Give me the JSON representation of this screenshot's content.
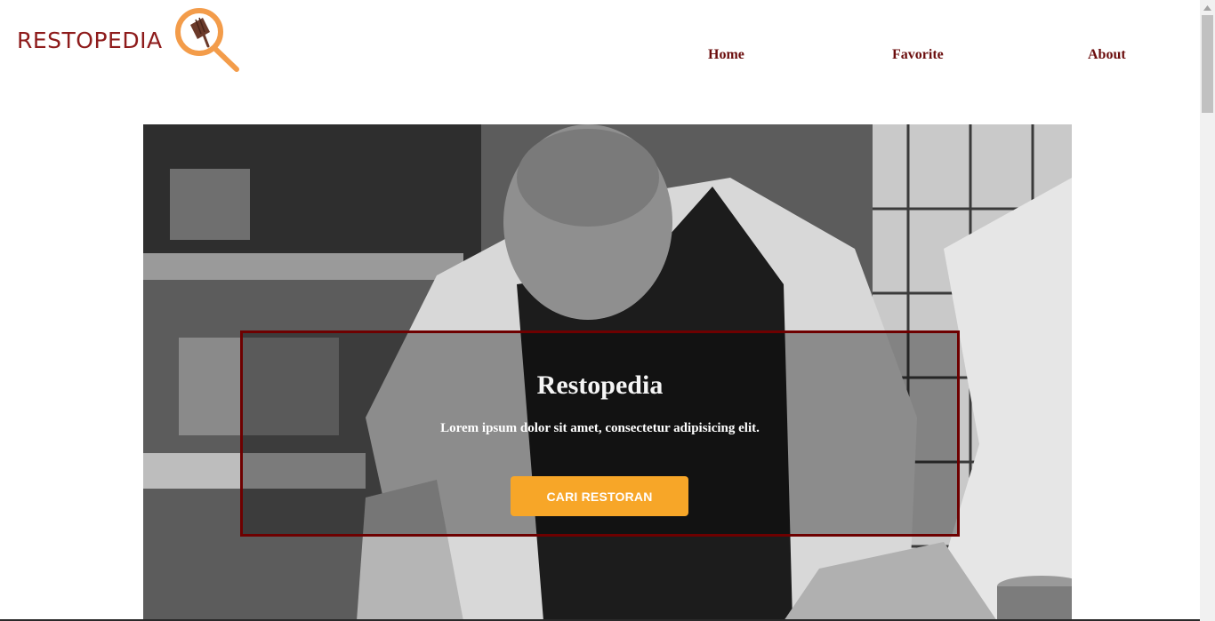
{
  "header": {
    "logo_text": "RESTOPEDIA"
  },
  "nav": {
    "home": "Home",
    "favorite": "Favorite",
    "about": "About"
  },
  "hero": {
    "title": "Restopedia",
    "subtitle": "Lorem ipsum dolor sit amet, consectetur adipisicing elit.",
    "button_label": "CARI RESTORAN"
  },
  "colors": {
    "brand": "#8e1b1b",
    "nav_text": "#6b0d0d",
    "button": "#f7a628",
    "hero_border": "#6e0000",
    "logo_orange": "#f39c4a"
  },
  "icons": {
    "logo": "magnifier-fork-icon"
  }
}
